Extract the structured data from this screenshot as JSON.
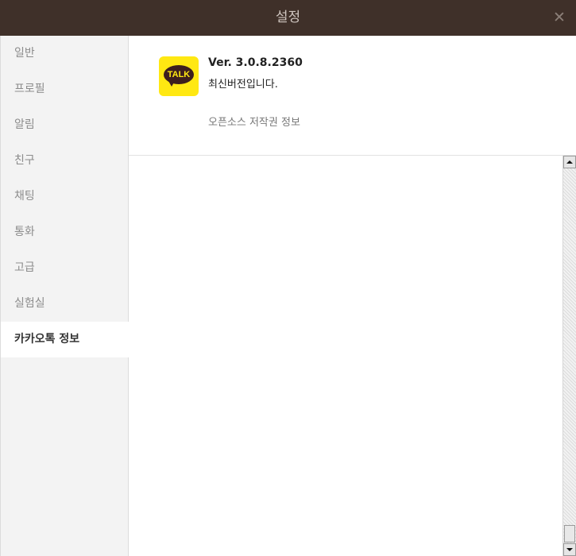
{
  "window": {
    "title": "설정",
    "close_glyph": "✕"
  },
  "sidebar": {
    "items": [
      {
        "label": "일반"
      },
      {
        "label": "프로필"
      },
      {
        "label": "알림"
      },
      {
        "label": "친구"
      },
      {
        "label": "채팅"
      },
      {
        "label": "통화"
      },
      {
        "label": "고급"
      },
      {
        "label": "실험실"
      },
      {
        "label": "카카오톡 정보"
      }
    ],
    "active_index": 8
  },
  "about": {
    "logo_text": "TALK",
    "version": "Ver. 3.0.8.2360",
    "status": "최신버전입니다.",
    "license_link": "오픈소스 저작권 정보"
  },
  "colors": {
    "titlebar": "#3f3029",
    "logo_bg": "#ffe812",
    "logo_bubble": "#3c1e1e"
  }
}
